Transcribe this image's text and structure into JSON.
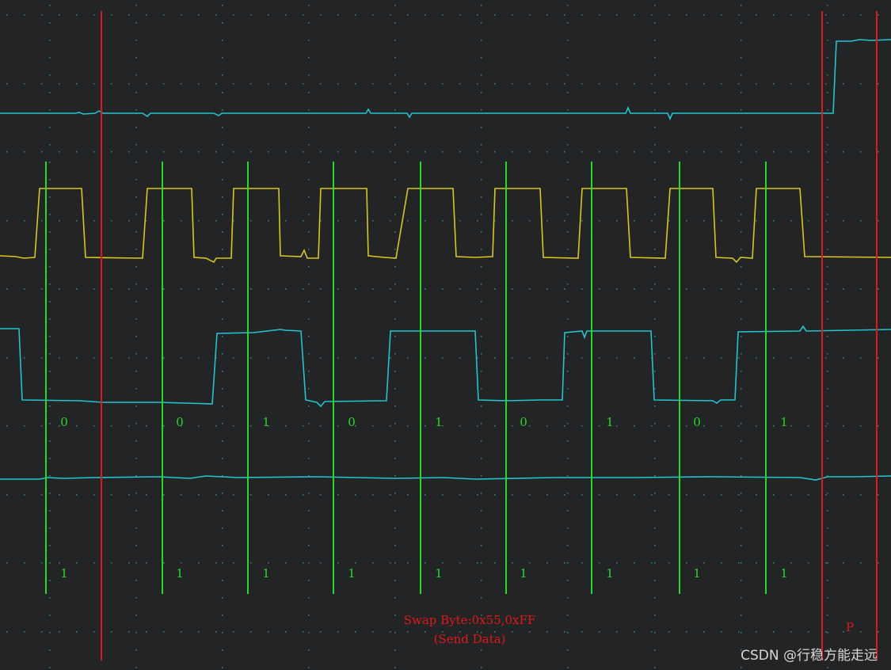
{
  "display": {
    "background": "#222426",
    "grid_color": "#2f8f86",
    "channel_colors": {
      "top": "#23c4cf",
      "clock": "#d8c81c",
      "data": "#23c4cf",
      "bottom": "#23c4cf"
    },
    "marker_color_green": "#22dd22",
    "marker_color_red": "#e01818"
  },
  "decoded_bits": {
    "data_row": [
      "0",
      "0",
      "1",
      "0",
      "1",
      "0",
      "1",
      "0",
      "1"
    ],
    "ack_row": [
      "1",
      "1",
      "1",
      "1",
      "1",
      "1",
      "1",
      "1",
      "1"
    ]
  },
  "annotation": {
    "line1": "Swap Byte:0x55,0xFF",
    "line2": "(Send Data)",
    "stop_label": "P"
  },
  "watermark": "CSDN @行稳方能走远"
}
